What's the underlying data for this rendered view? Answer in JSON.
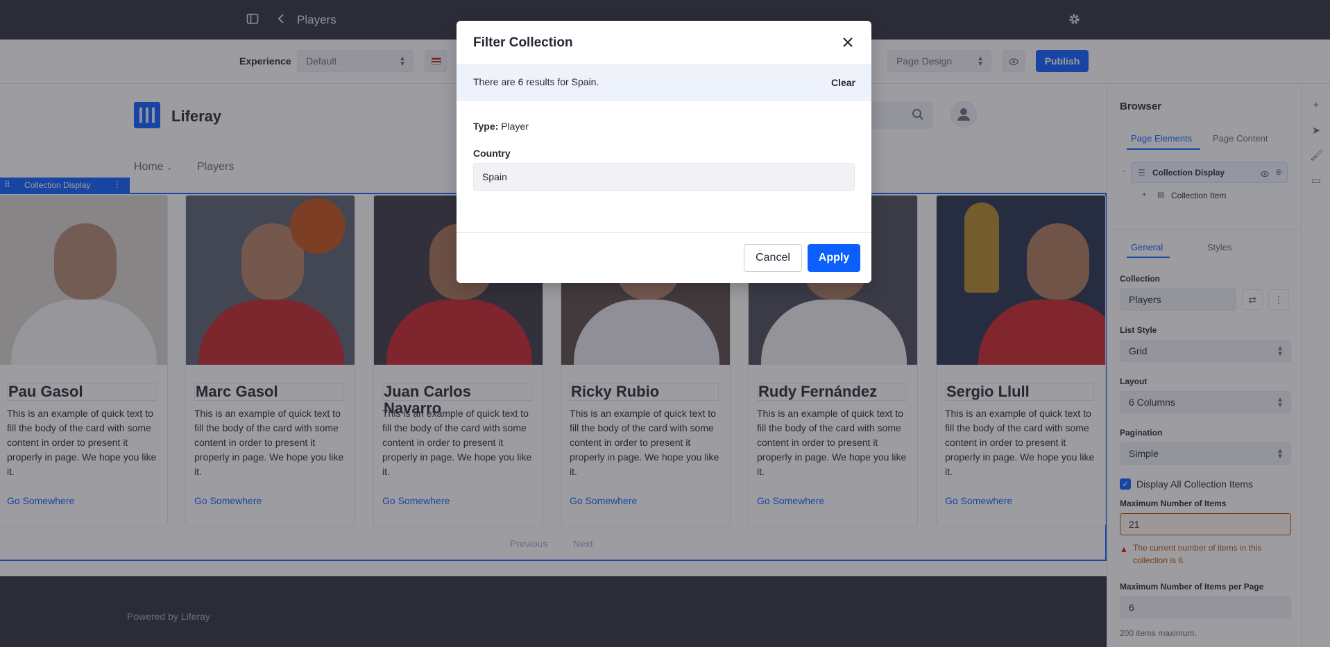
{
  "topbar": {
    "title": "Players",
    "icons": [
      "sidebar-toggle-icon",
      "chevron-left-icon",
      "gear-icon"
    ]
  },
  "toolbar": {
    "experience_label": "Experience",
    "experience_value": "Default",
    "page_design_value": "Page Design",
    "publish_label": "Publish",
    "icons": [
      "flag-icon",
      "eye-icon"
    ]
  },
  "site": {
    "name": "Liferay",
    "nav": [
      {
        "label": "Home"
      },
      {
        "label": "Players"
      }
    ]
  },
  "fragment": {
    "label": "Collection Display"
  },
  "cards": [
    {
      "name": "Pau Gasol",
      "desc": "This is an example of quick text to fill the body of the card with some content in order to present it properly in page. We hope you like it.",
      "link": "Go Somewhere"
    },
    {
      "name": "Marc Gasol",
      "desc": "This is an example of quick text to fill the body of the card with some content in order to present it properly in page. We hope you like it.",
      "link": "Go Somewhere"
    },
    {
      "name": "Juan Carlos Navarro",
      "desc": "This is an example of quick text to fill the body of the card with some content in order to present it properly in page. We hope you like it.",
      "link": "Go Somewhere"
    },
    {
      "name": "Ricky Rubio",
      "desc": "This is an example of quick text to fill the body of the card with some content in order to present it properly in page. We hope you like it.",
      "link": "Go Somewhere"
    },
    {
      "name": "Rudy Fernández",
      "desc": "This is an example of quick text to fill the body of the card with some content in order to present it properly in page. We hope you like it.",
      "link": "Go Somewhere"
    },
    {
      "name": "Sergio Llull",
      "desc": "This is an example of quick text to fill the body of the card with some content in order to present it properly in page. We hope you like it.",
      "link": "Go Somewhere"
    }
  ],
  "pagination": {
    "previous": "Previous",
    "next": "Next"
  },
  "footer": {
    "text": "Powered by Liferay"
  },
  "sidebar": {
    "title": "Browser",
    "tabs": [
      "Page Elements",
      "Page Content"
    ],
    "tree": {
      "parent": "Collection Display",
      "child": "Collection Item"
    },
    "config_tabs": [
      "General",
      "Styles"
    ],
    "collection_label": "Collection",
    "collection_value": "Players",
    "list_style_label": "List Style",
    "list_style_value": "Grid",
    "layout_label": "Layout",
    "layout_value": "6 Columns",
    "pagination_label": "Pagination",
    "pagination_value": "Simple",
    "display_all_label": "Display All Collection Items",
    "max_items_label": "Maximum Number of Items",
    "max_items_value": "21",
    "warning": "The current number of items in this collection is 6.",
    "max_per_page_label": "Maximum Number of Items per Page",
    "max_per_page_value": "6",
    "max_hint": "200 items maximum."
  },
  "rail_icons": [
    "plus-icon",
    "cursor-icon",
    "paint-roller-icon",
    "comment-icon"
  ],
  "modal": {
    "title": "Filter Collection",
    "results_message": "There are 6 results for Spain.",
    "clear_label": "Clear",
    "type_label": "Type:",
    "type_value": "Player",
    "country_label": "Country",
    "country_value": "Spain",
    "cancel_label": "Cancel",
    "apply_label": "Apply"
  },
  "colors": {
    "primary": "#0b5fff",
    "dark_bar": "#30313f",
    "overlay": "#272833"
  }
}
